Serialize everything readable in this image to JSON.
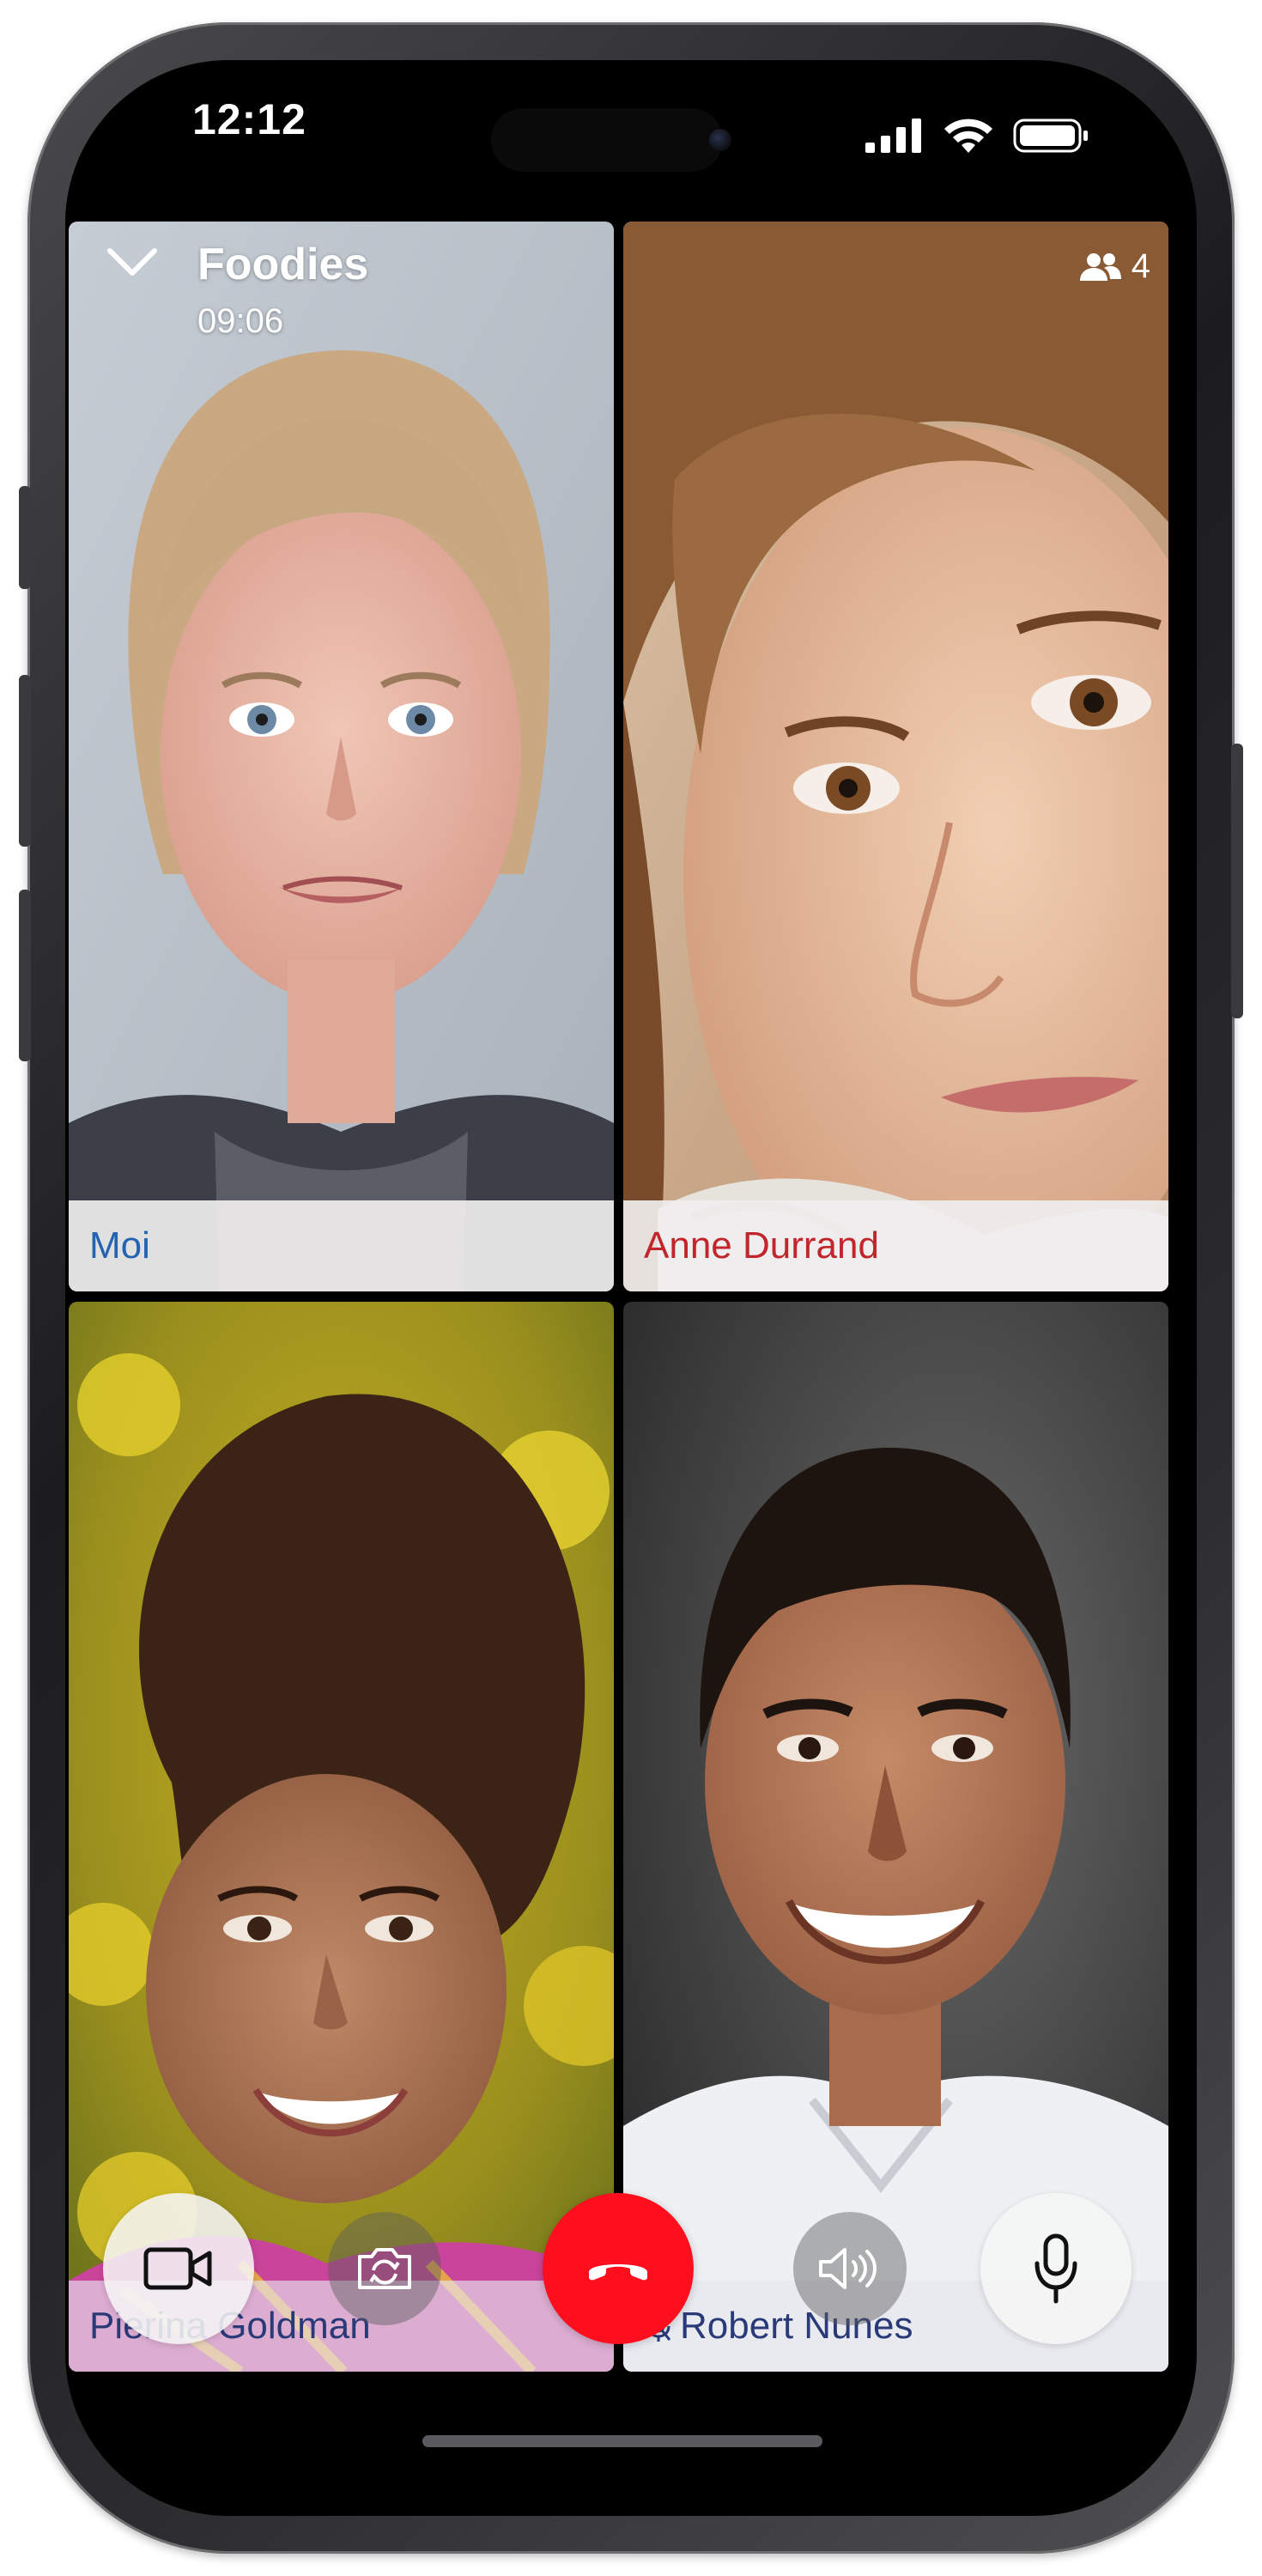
{
  "status_bar": {
    "time": "12:12",
    "signal_icon": "cellular-signal-icon",
    "wifi_icon": "wifi-icon",
    "battery_icon": "battery-icon"
  },
  "call": {
    "group_name": "Foodies",
    "duration": "09:06",
    "participant_count": "4",
    "collapse_icon": "chevron-down-icon",
    "participants_icon": "people-icon"
  },
  "tiles": [
    {
      "name": "Moi",
      "color": "#2463b0",
      "muted": false
    },
    {
      "name": "Anne Durrand",
      "color": "#c0262c",
      "muted": false
    },
    {
      "name": "Pierina Goldman",
      "color": "#2a3a78",
      "muted": false
    },
    {
      "name": "Robert Nunes",
      "color": "#2a3a78",
      "muted": true
    }
  ],
  "controls": {
    "video_icon": "video-camera-icon",
    "flip_camera_icon": "flip-camera-icon",
    "hang_up_icon": "phone-hangup-icon",
    "speaker_icon": "speaker-icon",
    "microphone_icon": "microphone-icon",
    "hang_up_color": "#ff0f1e"
  }
}
